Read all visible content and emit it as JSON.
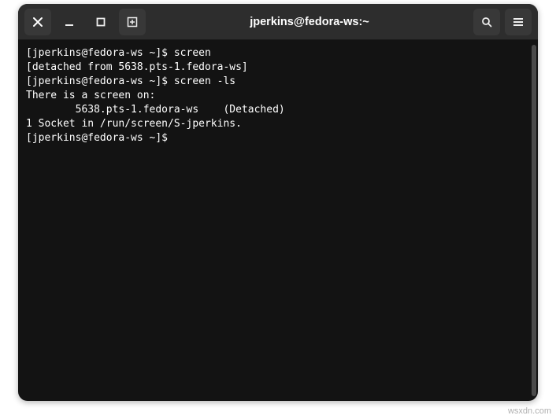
{
  "window": {
    "title": "jperkins@fedora-ws:~"
  },
  "terminal": {
    "lines": [
      {
        "prompt": "[jperkins@fedora-ws ~]$ ",
        "cmd": "screen"
      },
      {
        "text": "[detached from 5638.pts-1.fedora-ws]"
      },
      {
        "prompt": "[jperkins@fedora-ws ~]$ ",
        "cmd": "screen -ls"
      },
      {
        "text": "There is a screen on:"
      },
      {
        "text": "        5638.pts-1.fedora-ws    (Detached)"
      },
      {
        "text": "1 Socket in /run/screen/S-jperkins."
      },
      {
        "prompt": "[jperkins@fedora-ws ~]$ ",
        "cmd": ""
      }
    ]
  },
  "watermark": "wsxdn.com"
}
